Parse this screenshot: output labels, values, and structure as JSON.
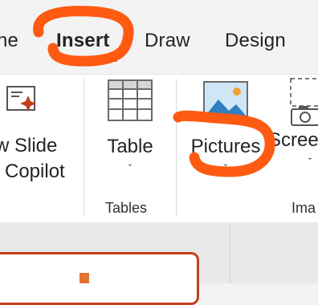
{
  "tabs": {
    "home_fragment": "ne",
    "insert": "Insert",
    "draw": "Draw",
    "design": "Design"
  },
  "ribbon": {
    "new_slide": {
      "line1": "w Slide",
      "line2": "Copilot"
    },
    "table": {
      "label": "Table",
      "chevron": "ˇ"
    },
    "tables_group_label": "Tables",
    "pictures": {
      "label": "Pictures",
      "chevron": "ˇ"
    },
    "screenshot_fragment": {
      "label": "Scree",
      "chevron": "ˇ"
    },
    "images_group_fragment": "Ima"
  },
  "colors": {
    "accent": "#c43e1c",
    "annotation": "#ff5a12",
    "ribbon_bg": "#ffffff",
    "tab_bg": "#f3f3f3"
  },
  "icons": {
    "new_slide": "new-slide-sparkle-icon",
    "table": "table-grid-icon",
    "pictures": "landscape-picture-icon",
    "screenshot": "camera-screenshot-icon"
  }
}
